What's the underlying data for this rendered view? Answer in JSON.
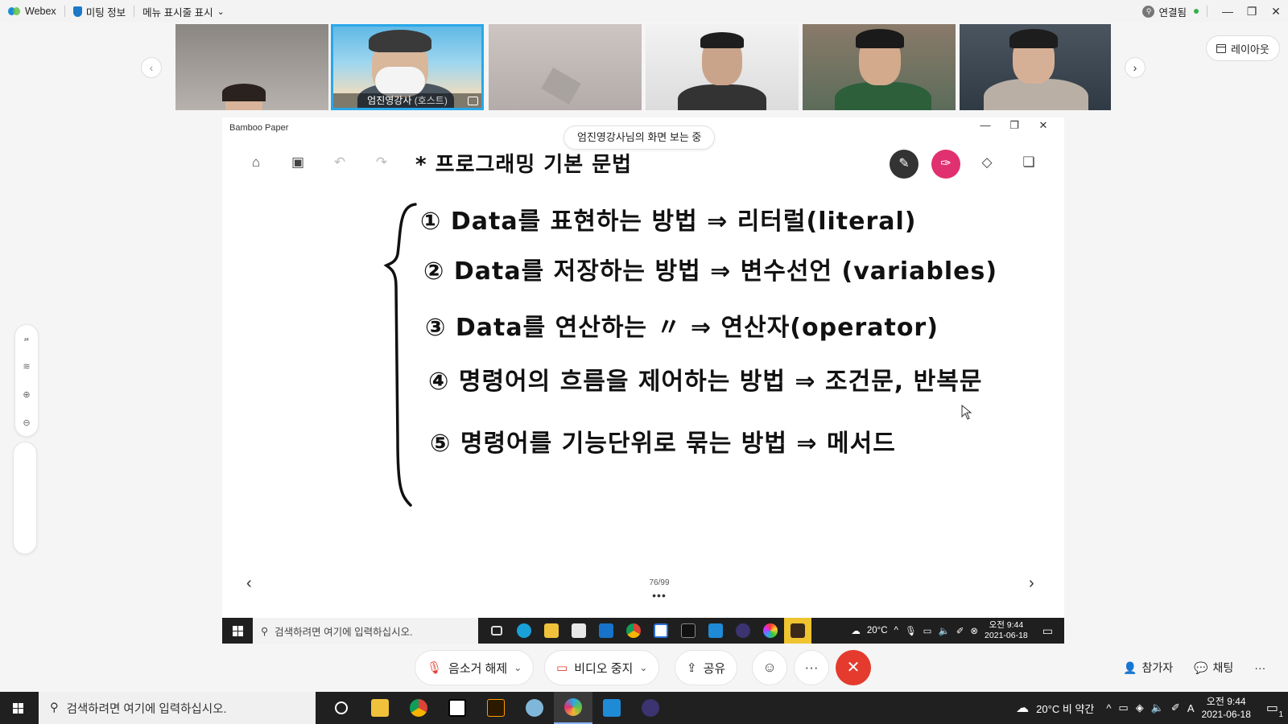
{
  "webex_bar": {
    "app_name": "Webex",
    "meeting_info": "미팅 정보",
    "menu_toggle": "메뉴 표시줄 표시",
    "connection": "연결됨",
    "win_min": "—",
    "win_restore": "❐",
    "win_close": "✕"
  },
  "participants": {
    "prev_arrow": "‹",
    "next_arrow": "›",
    "host_name": "엄진영강사",
    "host_tag": "(호스트)",
    "layout_label": "레이아웃"
  },
  "shared_app": {
    "window_title": "Bamboo Paper",
    "viewing_badge": "엄진영강사님의 화면 보는 중",
    "win_min": "—",
    "win_restore": "❐",
    "win_close": "✕",
    "page_indicator": "76/99",
    "dots": "•••",
    "prev_page": "‹",
    "next_page": "›",
    "toolbar": {
      "home": "⌂",
      "image": "▣",
      "undo": "↶",
      "redo": "↷",
      "pen": "✎",
      "marker": "✑",
      "eraser": "◇",
      "copy": "❏"
    },
    "side_tools": [
      "𝓃",
      "≋",
      "⊕",
      "⊖"
    ],
    "notes": {
      "title": "* 프로그래밍 기본 문법",
      "lines": [
        "① Data를 표현하는 방법 ⇒ 리터럴(literal)",
        "② Data를 저장하는 방법 ⇒ 변수선언 (variables)",
        "③ Data를 연산하는 〃 ⇒ 연산자(operator)",
        "④ 명령어의 흐름을 제어하는 방법 ⇒ 조건문, 반복문",
        "⑤ 명령어를 기능단위로 묶는 방법 ⇒ 메서드"
      ]
    },
    "taskbar": {
      "search_placeholder": "검색하려면 여기에 입력하십시오.",
      "weather": "20°C",
      "time": "오전 9:44",
      "date": "2021-06-18"
    }
  },
  "meeting_controls": {
    "mute_label": "음소거 해제",
    "video_label": "비디오 중지",
    "share_label": "공유",
    "emoji": "☺",
    "more": "···",
    "end": "✕",
    "participants_label": "참가자",
    "chat_label": "채팅",
    "right_more": "···"
  },
  "host_taskbar": {
    "search_placeholder": "검색하려면 여기에 입력하십시오.",
    "weather": "20°C 비 약간",
    "ime": "A",
    "time": "오전 9:44",
    "date": "2021-06-18",
    "notif_count": "1"
  },
  "colors": {
    "accent_blue": "#2aa7e8",
    "end_red": "#e43b2e",
    "marker_pink": "#e0306f",
    "taskbar": "#202020"
  }
}
